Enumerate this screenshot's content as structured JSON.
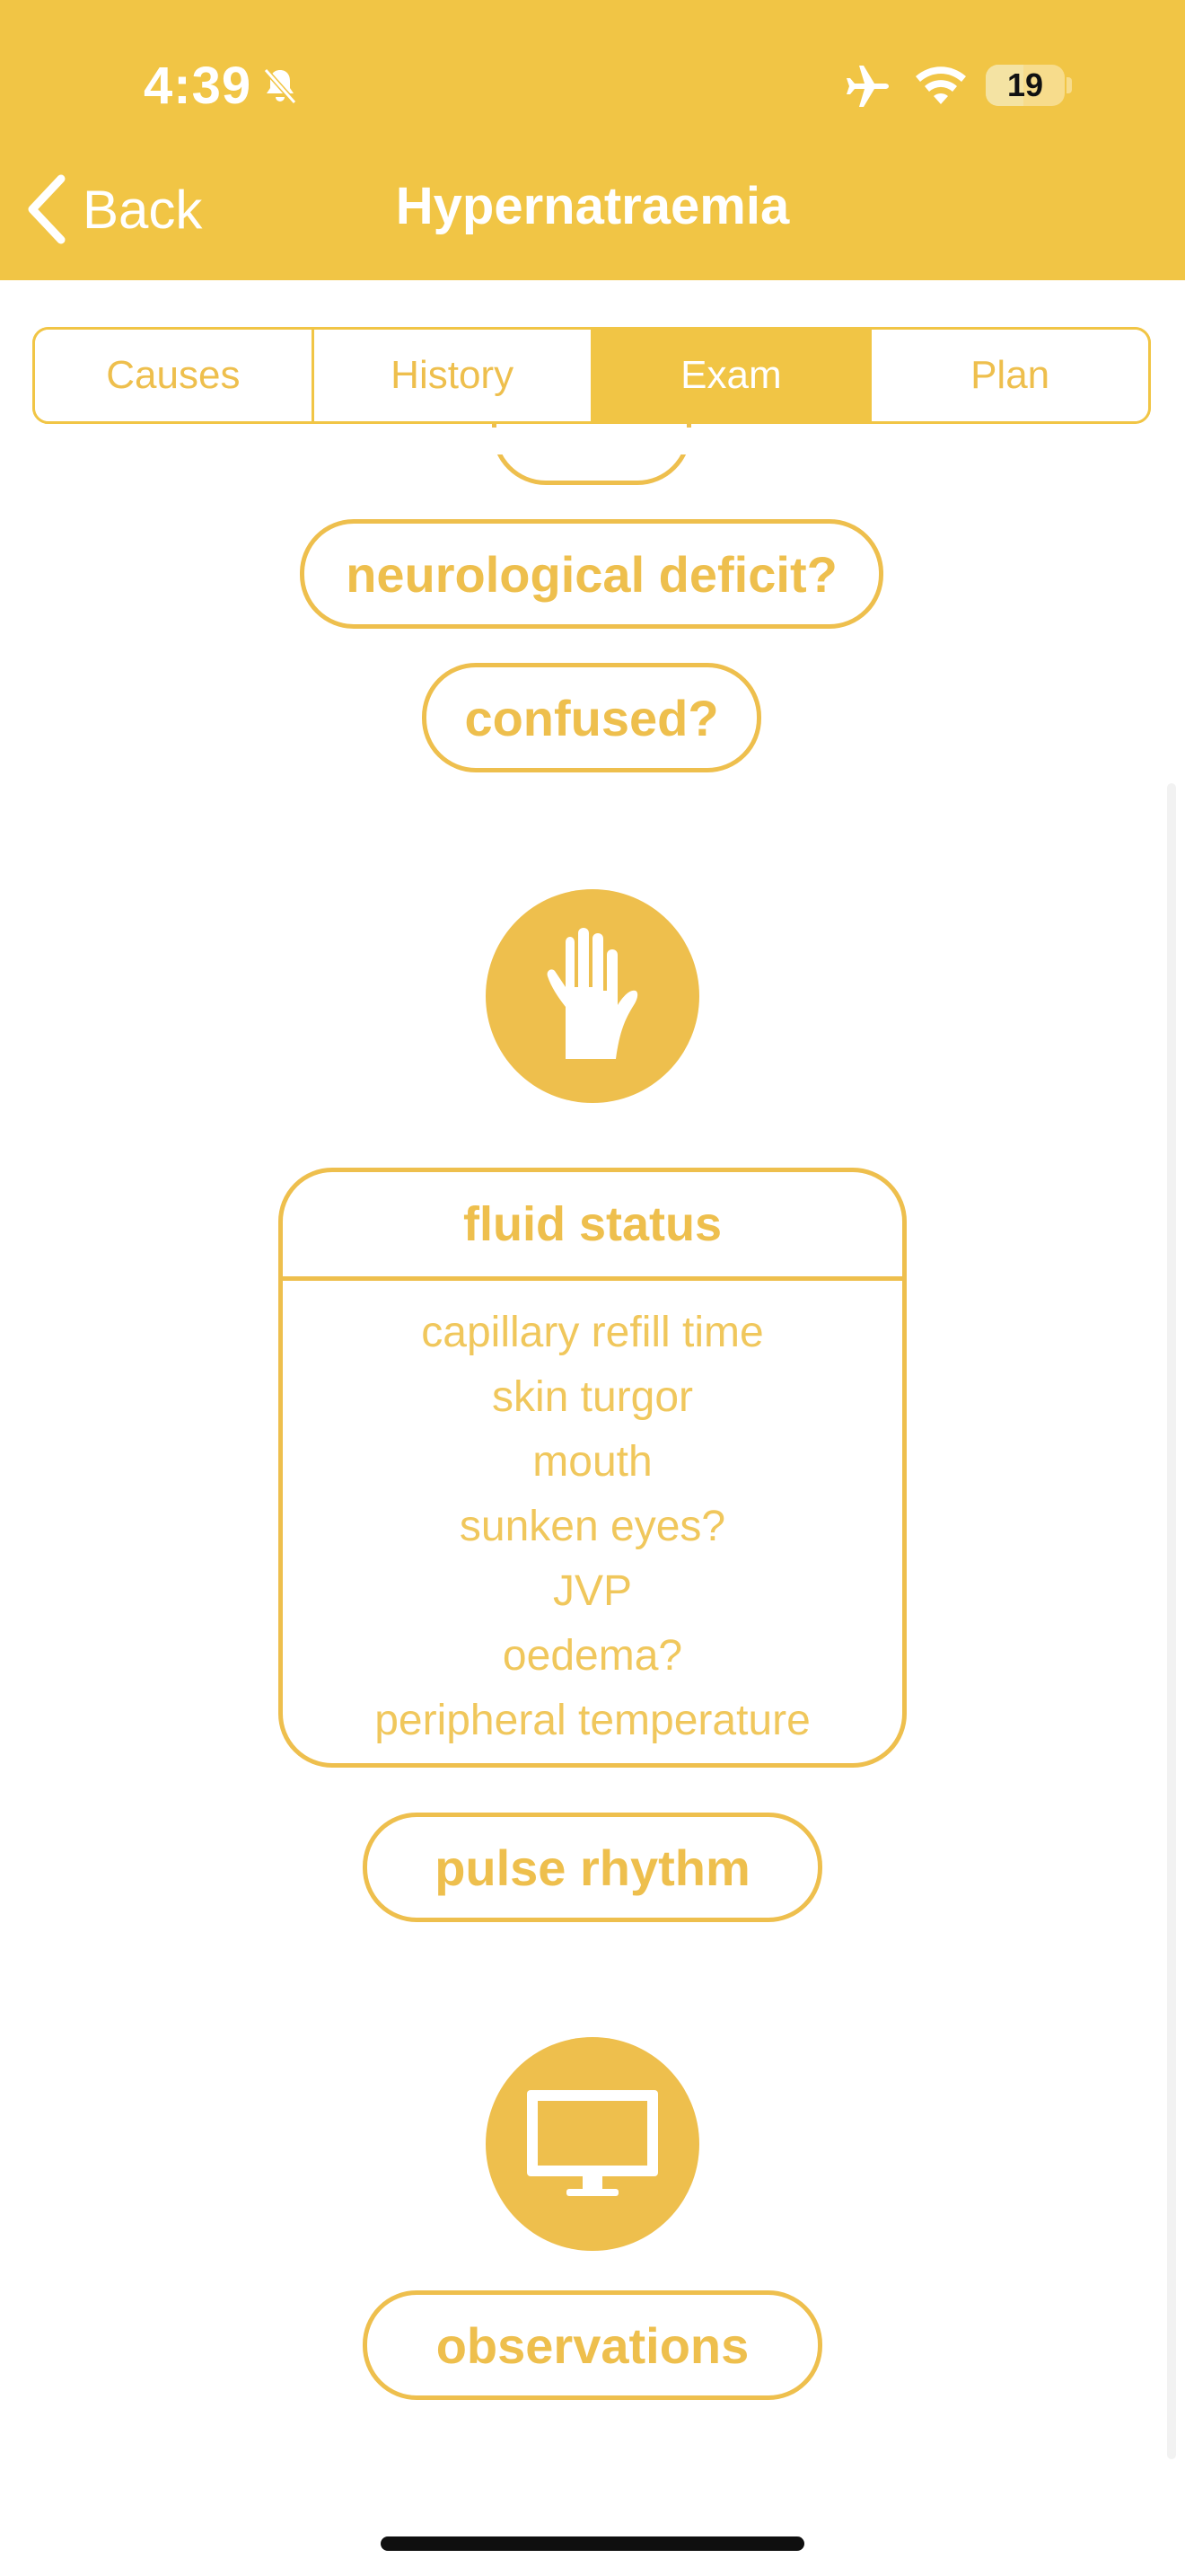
{
  "status_bar": {
    "time": "4:39",
    "battery": "19",
    "icons": [
      "bell-slash-icon",
      "airplane-icon",
      "wifi-icon",
      "battery-icon"
    ]
  },
  "nav": {
    "back_label": "Back",
    "title": "Hypernatraemia"
  },
  "tabs": [
    {
      "label": "Causes",
      "selected": false
    },
    {
      "label": "History",
      "selected": false
    },
    {
      "label": "Exam",
      "selected": true
    },
    {
      "label": "Plan",
      "selected": false
    }
  ],
  "content": {
    "pill_neuro": "neurological deficit?",
    "pill_confused": "confused?",
    "exam_icon": "hand-icon",
    "fluid_card": {
      "title": "fluid status",
      "items": [
        "capillary refill time",
        "skin turgor",
        "mouth",
        "sunken eyes?",
        "JVP",
        "oedema?",
        "peripheral temperature"
      ]
    },
    "pill_pulse": "pulse rhythm",
    "monitor_icon": "monitor-icon",
    "pill_obs": "observations"
  },
  "colors": {
    "header": "#f1c545",
    "accent": "#eebf4d",
    "text_light": "#f0c75c"
  }
}
